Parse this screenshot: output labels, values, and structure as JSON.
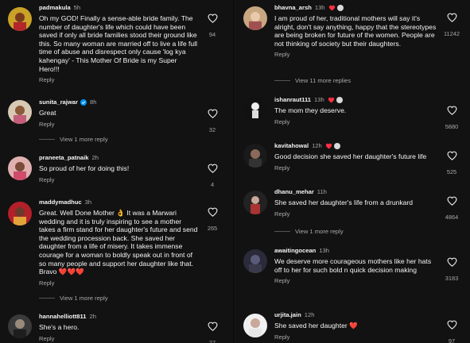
{
  "left_comments": [
    {
      "username": "padmakula",
      "time": "5h",
      "verified": false,
      "likes": "94",
      "text": "Oh my GOD! Finally a sense-able bride family. The number of daughter's life which could have been saved if only all bride families stood their ground like this. So many woman are married off to live a life full time of abuse and disrespect only cause 'log kya kahengay' - This Mother Of Bride is my Super Hero!!!",
      "reply": "Reply",
      "view_more": ""
    },
    {
      "username": "sunita_rajwar",
      "time": "8h",
      "verified": true,
      "likes": "32",
      "text": "Great",
      "reply": "Reply",
      "view_more": "View 1 more reply"
    },
    {
      "username": "praneeta_patnaik",
      "time": "2h",
      "verified": false,
      "likes": "4",
      "text": "So proud of her for doing this!",
      "reply": "Reply",
      "view_more": ""
    },
    {
      "username": "maddymadhuc",
      "time": "3h",
      "verified": false,
      "likes": "265",
      "text": "Great. Well Done Mother 👌 It was a Marwari wedding and it is  truly inspiring to see a mother takes a firm stand for her daughter's future and send the wedding procession back. She saved her daughter from a life of misery. It takes immense courage for a woman to boldly speak out in front of so many people and support her daughter like that. Bravo ❤️❤️❤️",
      "reply": "Reply",
      "view_more": "View 1 more reply"
    },
    {
      "username": "hannahelliott811",
      "time": "2h",
      "verified": false,
      "likes": "27",
      "text": "She's a hero.",
      "reply": "Reply",
      "view_more": ""
    }
  ],
  "right_comments": [
    {
      "username": "bhavna_arsh",
      "time": "13h",
      "liked_by_creator": true,
      "likes": "11242",
      "text": "I am proud of her, traditional mothers will say it's alright, don't say anything, happy that the stereotypes are being broken for future of the women. People are not thinking of society but their daughters.",
      "reply": "Reply",
      "view_more": "View 11 more replies"
    },
    {
      "username": "ishanraut111",
      "time": "13h",
      "liked_by_creator": true,
      "likes": "5880",
      "text": "The mom they deserve.",
      "reply": "Reply",
      "view_more": ""
    },
    {
      "username": "kavitahowal",
      "time": "12h",
      "liked_by_creator": true,
      "likes": "525",
      "text": "Good decision she saved her daughter's future life",
      "reply": "Reply",
      "view_more": ""
    },
    {
      "username": "dhanu_mehar",
      "time": "11h",
      "liked_by_creator": false,
      "likes": "4864",
      "text": "She saved her daughter's life from a drunkard",
      "reply": "Reply",
      "view_more": "View 1 more reply"
    },
    {
      "username": "awaitingocean",
      "time": "13h",
      "liked_by_creator": false,
      "likes": "3183",
      "text": "We deserve more courageous mothers like her hats off to her for such bold n quick decision making",
      "reply": "Reply",
      "view_more": ""
    },
    {
      "username": "urjita.jain",
      "time": "12h",
      "liked_by_creator": false,
      "likes": "97",
      "text": "She saved her daughter ❤️",
      "reply": "Reply",
      "view_more": ""
    }
  ],
  "colors": {
    "background": "#121212",
    "text": "#f5f5f5",
    "muted": "#a8a8a8",
    "heart_red": "#ff3040",
    "verified_blue": "#0095f6"
  },
  "icons": {
    "like": "heart-outline-icon",
    "creator_like": "red-heart-icon",
    "verified": "verified-badge-icon"
  }
}
